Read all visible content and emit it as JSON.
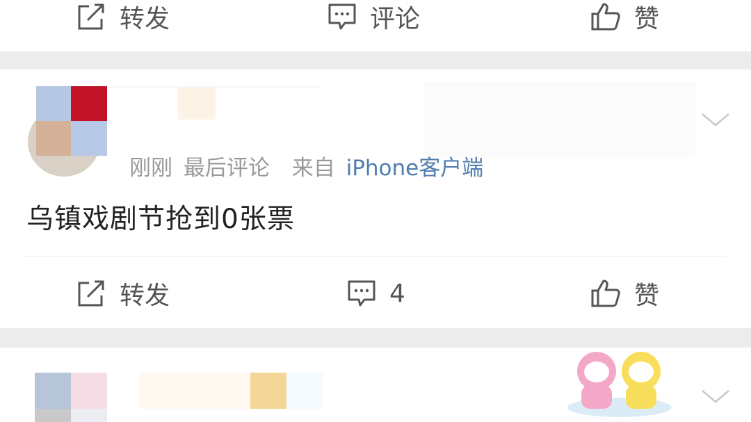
{
  "post1": {
    "actions": {
      "repost_label": "转发",
      "comment_label": "评论",
      "like_label": "赞"
    }
  },
  "post2": {
    "meta": {
      "time": "刚刚",
      "activity": "最后评论",
      "source_prefix": "来自",
      "source": "iPhone客户端"
    },
    "text": "乌镇戏剧节抢到0张票",
    "actions": {
      "repost_label": "转发",
      "comment_count": "4",
      "like_label": "赞"
    }
  },
  "icons": {
    "repost": "share-square-icon",
    "comment": "comment-bubble-icon",
    "like": "thumbs-up-icon",
    "menu": "chevron-down-icon"
  },
  "colors": {
    "source_link": "#507daf",
    "background": "#efefef"
  }
}
